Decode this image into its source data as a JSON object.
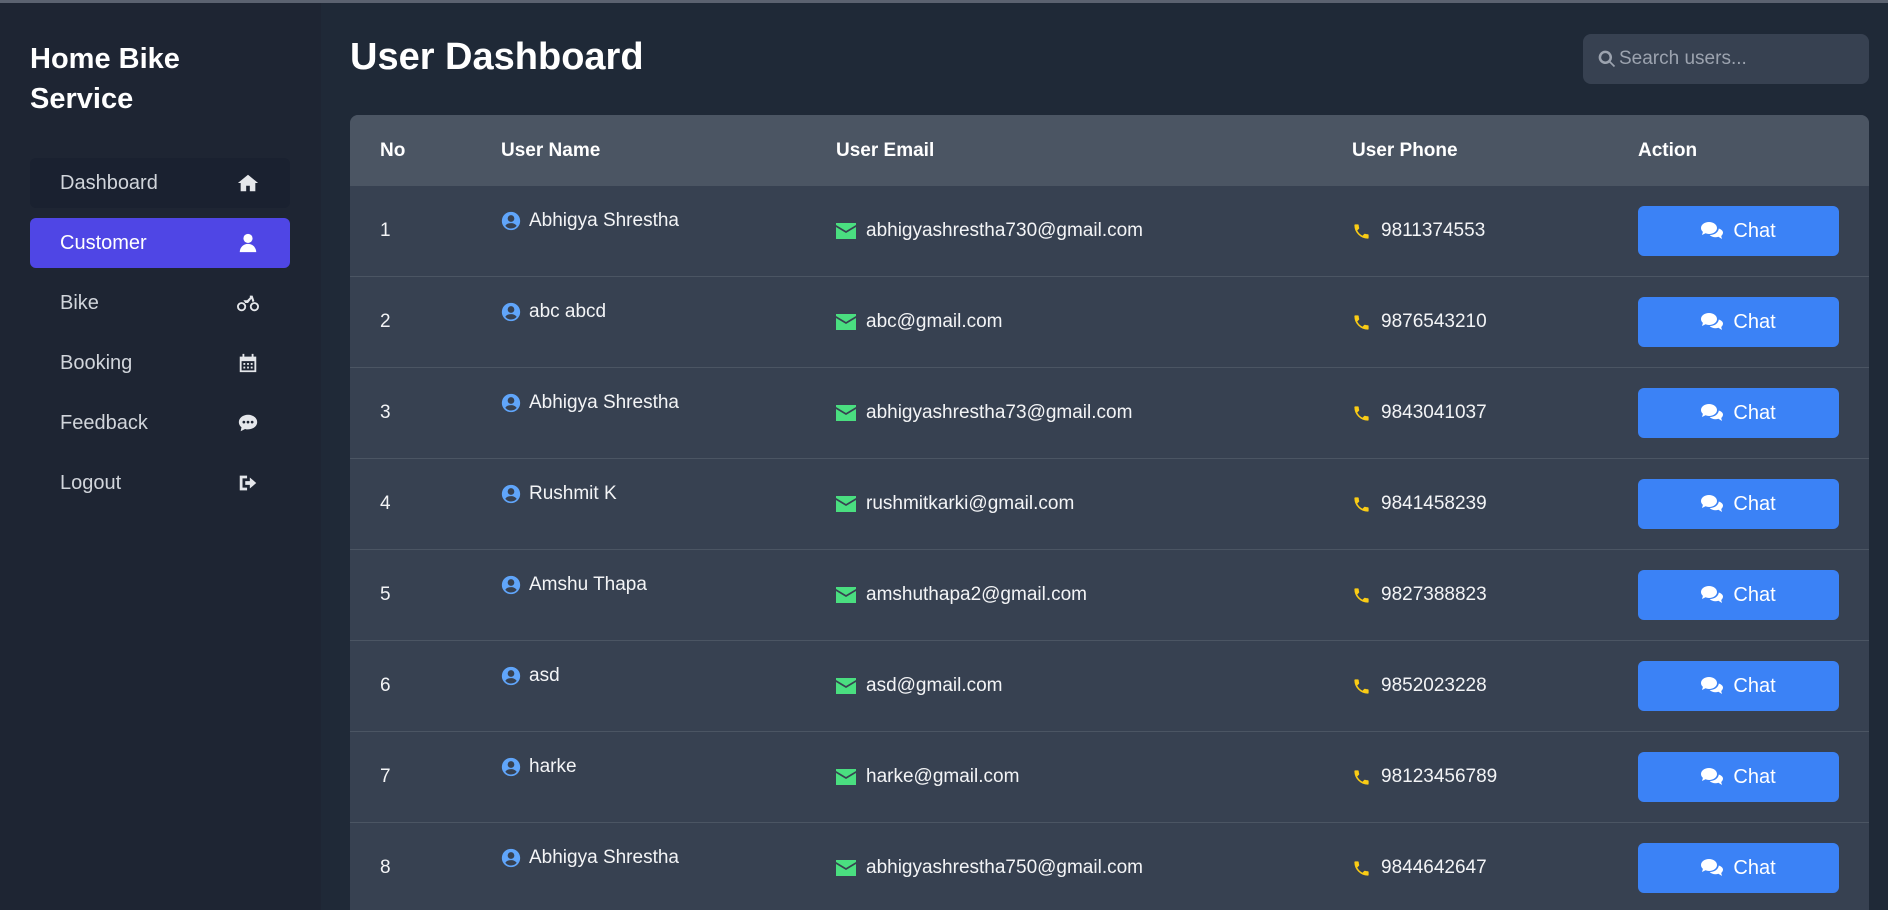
{
  "sidebar": {
    "brand": "Home Bike Service",
    "items": [
      {
        "label": "Dashboard",
        "icon": "home-icon"
      },
      {
        "label": "Customer",
        "icon": "user-icon"
      },
      {
        "label": "Bike",
        "icon": "motorcycle-icon"
      },
      {
        "label": "Booking",
        "icon": "calendar-icon"
      },
      {
        "label": "Feedback",
        "icon": "comment-icon"
      },
      {
        "label": "Logout",
        "icon": "sign-out-icon"
      }
    ],
    "active_item": "Customer"
  },
  "header": {
    "title": "User Dashboard",
    "search_placeholder": "Search users..."
  },
  "table": {
    "columns": [
      "No",
      "User Name",
      "User Email",
      "User Phone",
      "Action"
    ],
    "rows": [
      {
        "no": "1",
        "name": "Abhigya Shrestha",
        "email": "abhigyashrestha730@gmail.com",
        "phone": "9811374553",
        "action": "Chat"
      },
      {
        "no": "2",
        "name": "abc abcd",
        "email": "abc@gmail.com",
        "phone": "9876543210",
        "action": "Chat"
      },
      {
        "no": "3",
        "name": "Abhigya Shrestha",
        "email": "abhigyashrestha73@gmail.com",
        "phone": "9843041037",
        "action": "Chat"
      },
      {
        "no": "4",
        "name": "Rushmit K",
        "email": "rushmitkarki@gmail.com",
        "phone": "9841458239",
        "action": "Chat"
      },
      {
        "no": "5",
        "name": "Amshu Thapa",
        "email": "amshuthapa2@gmail.com",
        "phone": "9827388823",
        "action": "Chat"
      },
      {
        "no": "6",
        "name": "asd",
        "email": "asd@gmail.com",
        "phone": "9852023228",
        "action": "Chat"
      },
      {
        "no": "7",
        "name": "harke",
        "email": "harke@gmail.com",
        "phone": "98123456789",
        "action": "Chat"
      },
      {
        "no": "8",
        "name": "Abhigya Shrestha",
        "email": "abhigyashrestha750@gmail.com",
        "phone": "9844642647",
        "action": "Chat"
      }
    ]
  },
  "colors": {
    "background": "#1f2937",
    "sidebar": "#1e2533",
    "active_nav": "#4f46e5",
    "table_header": "#4b5563",
    "table_body": "#374151",
    "chat_button": "#3b82f6",
    "user_icon": "#60a5fa",
    "mail_icon": "#4ade80",
    "phone_icon": "#facc15"
  }
}
